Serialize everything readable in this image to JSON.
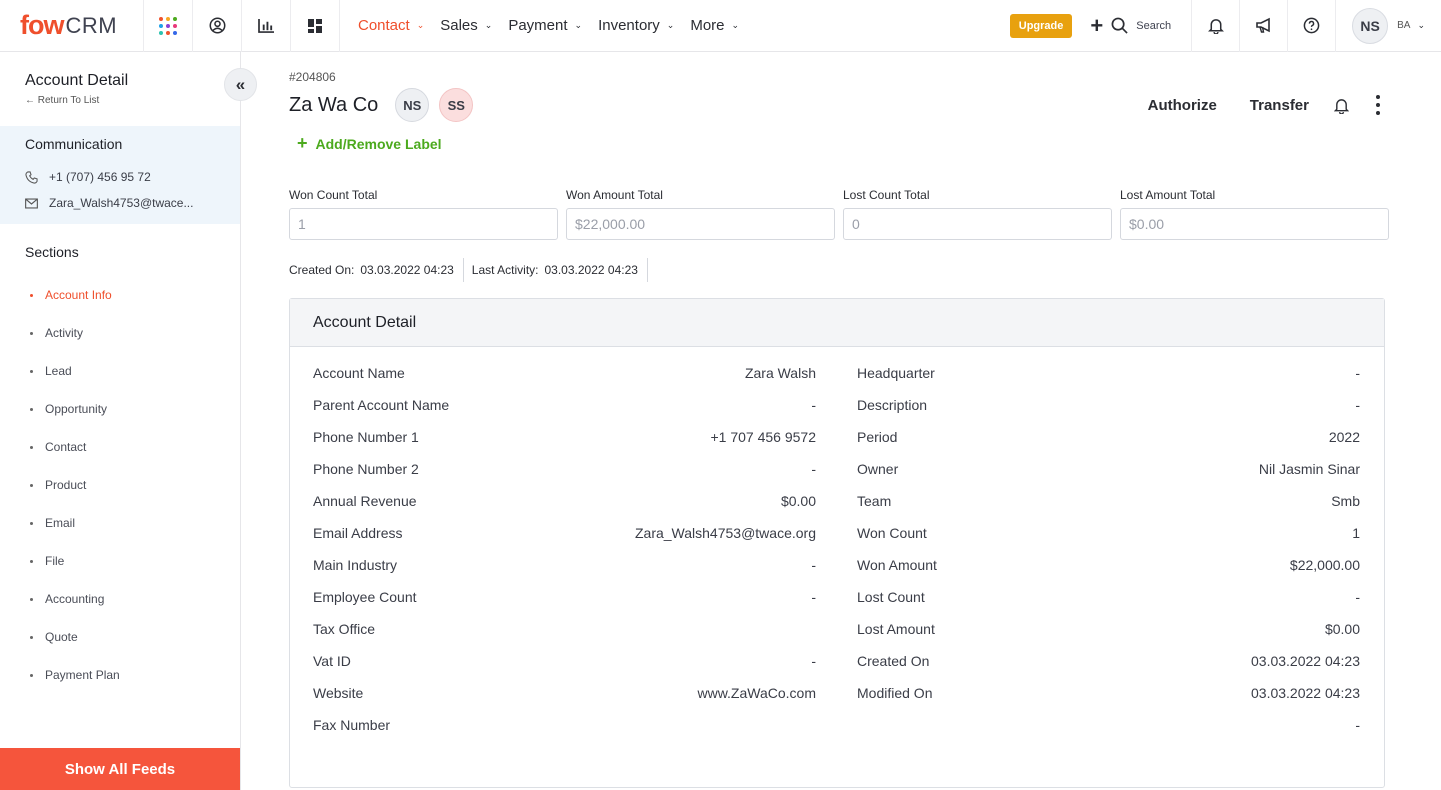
{
  "brand": {
    "logo_mark": "fow",
    "logo_text": "CRM",
    "accent": "#ef4f2c"
  },
  "topnav": {
    "items": [
      {
        "label": "Contact",
        "active": true
      },
      {
        "label": "Sales",
        "active": false
      },
      {
        "label": "Payment",
        "active": false
      },
      {
        "label": "Inventory",
        "active": false
      },
      {
        "label": "More",
        "active": false
      }
    ],
    "upgrade_label": "Upgrade",
    "search_label": "Search",
    "user_initials": "NS",
    "user_short": "BA"
  },
  "sidebar": {
    "title": "Account Detail",
    "back_label": "← Return To List",
    "communication_title": "Communication",
    "phone": "+1 (707) 456 95 72",
    "email": "Zara_Walsh4753@twace...",
    "sections_title": "Sections",
    "sections": [
      {
        "label": "Account Info",
        "active": true
      },
      {
        "label": "Activity"
      },
      {
        "label": "Lead"
      },
      {
        "label": "Opportunity"
      },
      {
        "label": "Contact"
      },
      {
        "label": "Product"
      },
      {
        "label": "Email"
      },
      {
        "label": "File"
      },
      {
        "label": "Accounting"
      },
      {
        "label": "Quote"
      },
      {
        "label": "Payment Plan"
      }
    ],
    "show_feeds_label": "Show All Feeds"
  },
  "record": {
    "id": "#204806",
    "name": "Za Wa Co",
    "badges": [
      "NS",
      "SS"
    ],
    "authorize_label": "Authorize",
    "transfer_label": "Transfer",
    "add_label": "Add/Remove Label"
  },
  "totals": [
    {
      "label": "Won Count Total",
      "value": "1"
    },
    {
      "label": "Won Amount Total",
      "value": "$22,000.00"
    },
    {
      "label": "Lost Count Total",
      "value": "0"
    },
    {
      "label": "Lost Amount Total",
      "value": "$0.00"
    }
  ],
  "meta": {
    "created_label": "Created On:",
    "created_value": "03.03.2022 04:23",
    "activity_label": "Last Activity:",
    "activity_value": "03.03.2022 04:23"
  },
  "detail": {
    "title": "Account Detail",
    "left": [
      {
        "k": "Account Name",
        "v": "Zara Walsh"
      },
      {
        "k": "Parent Account Name",
        "v": "-"
      },
      {
        "k": "Phone Number 1",
        "v": "+1 707 456 9572"
      },
      {
        "k": "Phone Number 2",
        "v": "-"
      },
      {
        "k": "Annual Revenue",
        "v": "$0.00"
      },
      {
        "k": "Email Address",
        "v": "Zara_Walsh4753@twace.org"
      },
      {
        "k": "Main Industry",
        "v": "-"
      },
      {
        "k": "Employee Count",
        "v": "-"
      },
      {
        "k": "Tax Office",
        "v": ""
      },
      {
        "k": "Vat ID",
        "v": "-"
      },
      {
        "k": "Website",
        "v": "www.ZaWaCo.com"
      },
      {
        "k": "Fax Number",
        "v": ""
      }
    ],
    "right": [
      {
        "k": "Headquarter",
        "v": "-"
      },
      {
        "k": "Description",
        "v": "-"
      },
      {
        "k": "Period",
        "v": "2022"
      },
      {
        "k": "Owner",
        "v": "Nil Jasmin Sinar"
      },
      {
        "k": "Team",
        "v": "Smb"
      },
      {
        "k": "Won Count",
        "v": "1"
      },
      {
        "k": "Won Amount",
        "v": "$22,000.00"
      },
      {
        "k": "Lost Count",
        "v": "-"
      },
      {
        "k": "Lost Amount",
        "v": "$0.00"
      },
      {
        "k": "Created On",
        "v": "03.03.2022 04:23"
      },
      {
        "k": "Modified On",
        "v": "03.03.2022 04:23"
      },
      {
        "k": "",
        "v": "-"
      }
    ]
  }
}
